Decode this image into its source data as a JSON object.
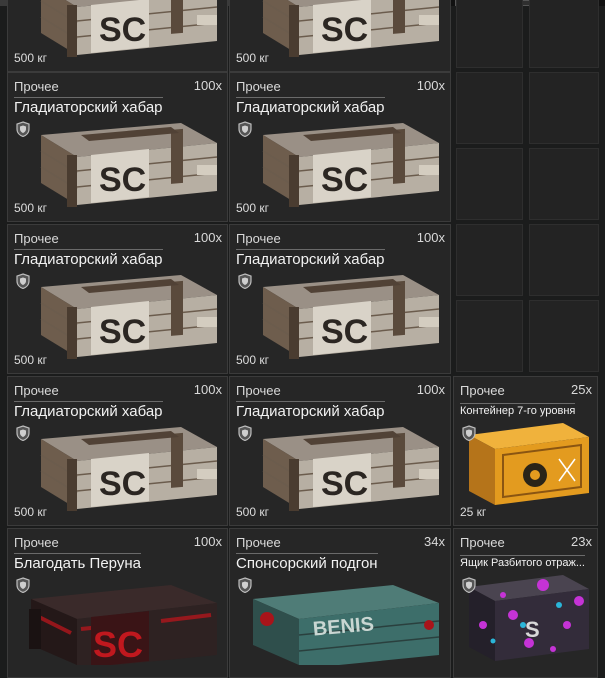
{
  "items": [
    {
      "category": "",
      "name": "",
      "qty": "",
      "weight": "500 кг",
      "kind": "gladiator"
    },
    {
      "category": "",
      "name": "",
      "qty": "",
      "weight": "500 кг",
      "kind": "gladiator"
    },
    {
      "category": "Прочее",
      "name": "Гладиаторский хабар",
      "qty": "100x",
      "weight": "500 кг",
      "kind": "gladiator"
    },
    {
      "category": "Прочее",
      "name": "Гладиаторский хабар",
      "qty": "100x",
      "weight": "500 кг",
      "kind": "gladiator"
    },
    {
      "category": "Прочее",
      "name": "Гладиаторский хабар",
      "qty": "100x",
      "weight": "500 кг",
      "kind": "gladiator"
    },
    {
      "category": "Прочее",
      "name": "Гладиаторский хабар",
      "qty": "100x",
      "weight": "500 кг",
      "kind": "gladiator"
    },
    {
      "category": "Прочее",
      "name": "Гладиаторский хабар",
      "qty": "100x",
      "weight": "500 кг",
      "kind": "gladiator"
    },
    {
      "category": "Прочее",
      "name": "Гладиаторский хабар",
      "qty": "100x",
      "weight": "500 кг",
      "kind": "gladiator"
    },
    {
      "category": "Прочее",
      "name": "Контейнер 7-го уровня",
      "qty": "25x",
      "weight": "25 кг",
      "kind": "container7"
    },
    {
      "category": "Прочее",
      "name": "Благодать Перуна",
      "qty": "100x",
      "weight": "",
      "kind": "perun"
    },
    {
      "category": "Прочее",
      "name": "Спонсорский подгон",
      "qty": "34x",
      "weight": "",
      "kind": "sponsor"
    },
    {
      "category": "Прочее",
      "name": "Ящик Разбитого отраж...",
      "qty": "23x",
      "weight": "",
      "kind": "mirror"
    }
  ],
  "icons": {
    "shield": "shield-icon"
  },
  "colors": {
    "crate_light": "#b9b2a6",
    "crate_dark": "#5a4a3c",
    "container_orange": "#e39b1f",
    "perun_red": "#b0161c",
    "sponsor_teal": "#3d6e6a",
    "mirror_purple": "#c533d6"
  }
}
